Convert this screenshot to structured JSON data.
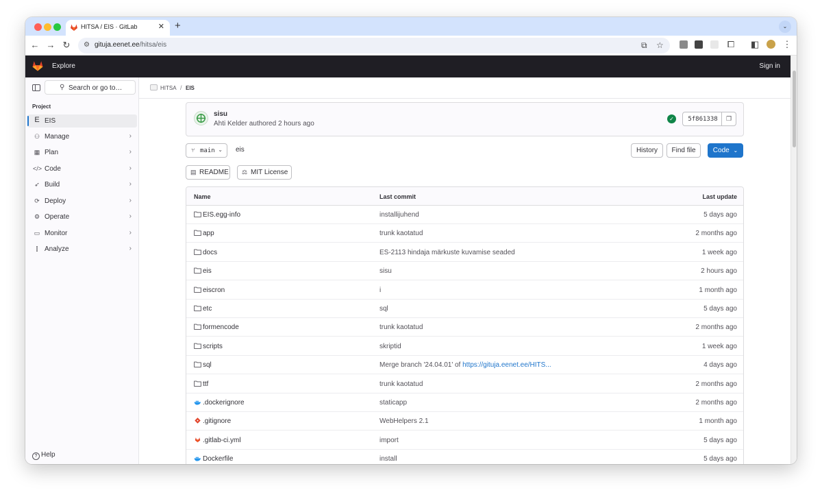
{
  "browser": {
    "tab_title": "HITSA / EIS · GitLab",
    "url_host": "gituja.eenet.ee",
    "url_path": "/hitsa/eis"
  },
  "topbar": {
    "explore_label": "Explore",
    "signin_label": "Sign in"
  },
  "sidebar": {
    "search_placeholder": "Search or go to…",
    "section_label": "Project",
    "project": {
      "avatar_letter": "E",
      "label": "EIS"
    },
    "items": [
      {
        "label": "Manage",
        "icon": "users-icon"
      },
      {
        "label": "Plan",
        "icon": "planning-icon"
      },
      {
        "label": "Code",
        "icon": "code-icon"
      },
      {
        "label": "Build",
        "icon": "rocket-icon"
      },
      {
        "label": "Deploy",
        "icon": "deploy-icon"
      },
      {
        "label": "Operate",
        "icon": "cloud-gear-icon"
      },
      {
        "label": "Monitor",
        "icon": "monitor-icon"
      },
      {
        "label": "Analyze",
        "icon": "chart-icon"
      }
    ],
    "help_label": "Help"
  },
  "breadcrumb": {
    "group": "HITSA",
    "project": "EIS"
  },
  "commit": {
    "title": "sisu",
    "meta": "Ahti Kelder authored 2 hours ago",
    "sha": "5f861338",
    "status_color": "#108548"
  },
  "repo": {
    "branch": "main",
    "path": "eis",
    "history_label": "History",
    "find_file_label": "Find file",
    "code_label": "Code"
  },
  "docs": {
    "readme_label": "README",
    "license_label": "MIT License"
  },
  "table": {
    "headers": {
      "name": "Name",
      "commit": "Last commit",
      "update": "Last update"
    },
    "rows": [
      {
        "name": "EIS.egg-info",
        "type": "folder",
        "commit": "installijuhend",
        "update": "5 days ago"
      },
      {
        "name": "app",
        "type": "folder",
        "commit": "trunk kaotatud",
        "update": "2 months ago"
      },
      {
        "name": "docs",
        "type": "folder",
        "commit": "ES-2113 hindaja märkuste kuvamise seaded",
        "update": "1 week ago"
      },
      {
        "name": "eis",
        "type": "folder",
        "commit": "sisu",
        "update": "2 hours ago"
      },
      {
        "name": "eiscron",
        "type": "folder",
        "commit": "i",
        "update": "1 month ago"
      },
      {
        "name": "etc",
        "type": "folder",
        "commit": "sql",
        "update": "5 days ago"
      },
      {
        "name": "formencode",
        "type": "folder",
        "commit": "trunk kaotatud",
        "update": "2 months ago"
      },
      {
        "name": "scripts",
        "type": "folder",
        "commit": "skriptid",
        "update": "1 week ago"
      },
      {
        "name": "sql",
        "type": "folder",
        "commit": "Merge branch '24.04.01' of ",
        "commit_link": "https://gituja.eenet.ee/HITS...",
        "update": "4 days ago"
      },
      {
        "name": "ttf",
        "type": "folder",
        "commit": "trunk kaotatud",
        "update": "2 months ago"
      },
      {
        "name": ".dockerignore",
        "type": "docker",
        "commit": "staticapp",
        "update": "2 months ago"
      },
      {
        "name": ".gitignore",
        "type": "git",
        "commit": "WebHelpers 2.1",
        "update": "1 month ago"
      },
      {
        "name": ".gitlab-ci.yml",
        "type": "gitlab",
        "commit": "import",
        "update": "5 days ago"
      },
      {
        "name": "Dockerfile",
        "type": "docker",
        "commit": "install",
        "update": "5 days ago"
      }
    ]
  },
  "colors": {
    "accent": "#1f75cb",
    "topbar": "#1f1e24",
    "tabstrip": "#d3e3fd",
    "gitlab_orange": "#fc6d26"
  }
}
